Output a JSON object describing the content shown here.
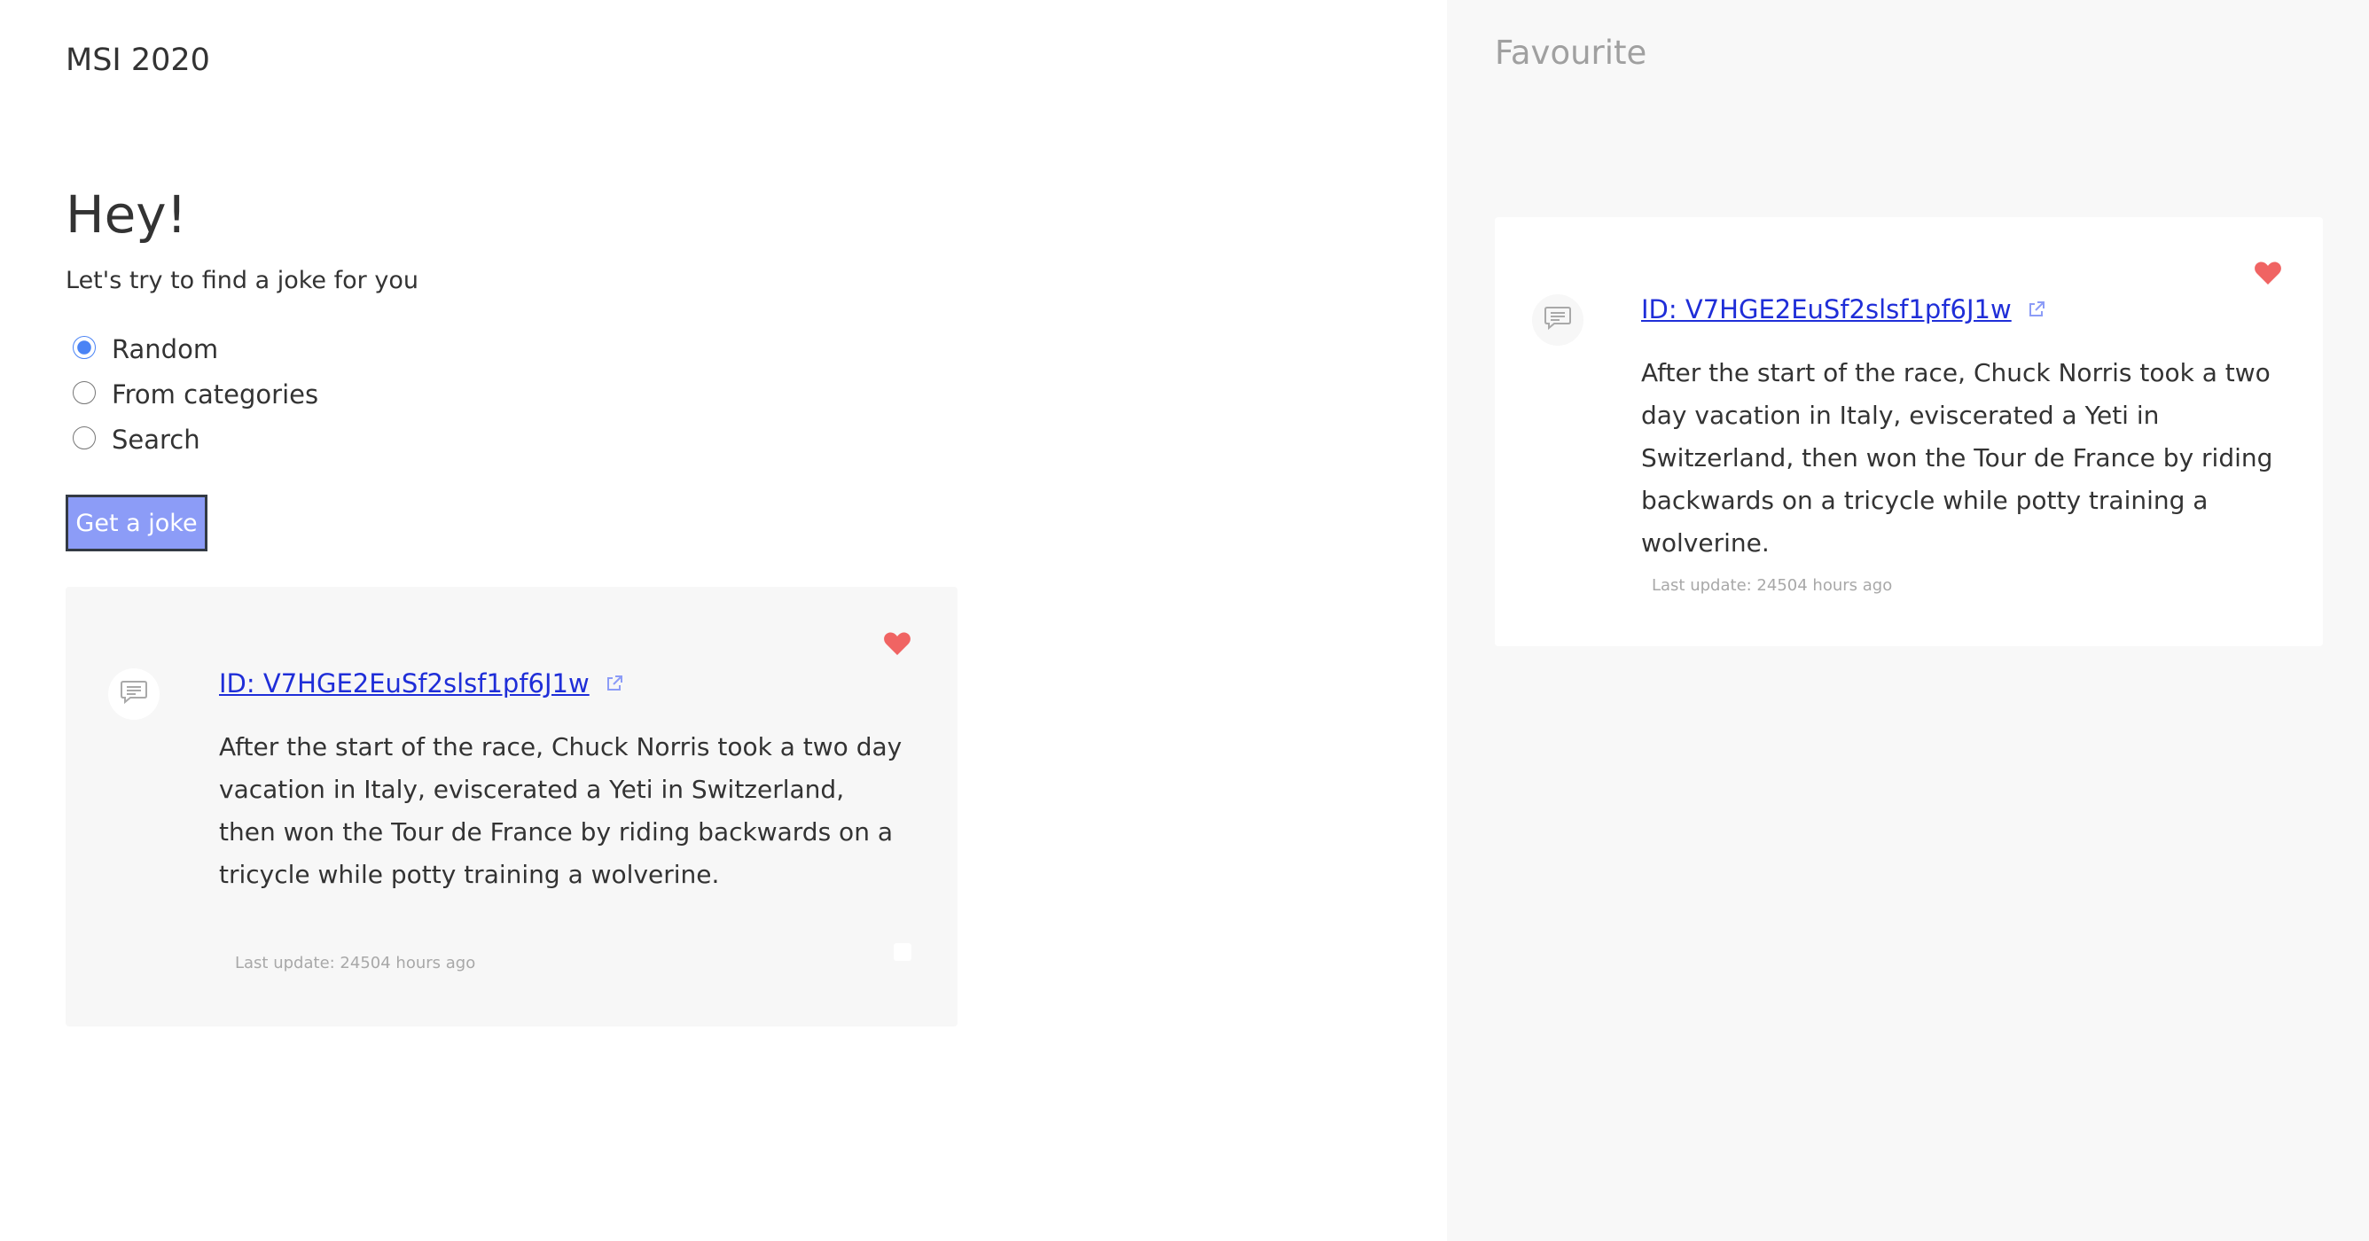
{
  "header": {
    "brand": "MSI 2020"
  },
  "main": {
    "greeting": "Hey!",
    "subtitle": "Let's try to find a joke for you",
    "radio_options": [
      {
        "label": "Random",
        "checked": true
      },
      {
        "label": "From categories",
        "checked": false
      },
      {
        "label": "Search",
        "checked": false
      }
    ],
    "get_joke_label": "Get a joke",
    "joke": {
      "id_text": "ID: V7HGE2EuSf2slsf1pf6J1w",
      "text": "After the start of the race, Chuck Norris took a two day vacation in Italy, eviscerated a Yeti in Switzerland, then won the Tour de France by riding backwards on a tricycle while potty training a wolverine.",
      "last_update": "Last update: 24504 hours ago",
      "favourite": true
    }
  },
  "sidebar": {
    "title": "Favourite",
    "items": [
      {
        "id_text": "ID: V7HGE2EuSf2slsf1pf6J1w",
        "text": "After the start of the race, Chuck Norris took a two day vacation in Italy, eviscerated a Yeti in Switzerland, then won the Tour de France by riding backwards on a tricycle while potty training a wolverine.",
        "last_update": "Last update: 24504 hours ago",
        "favourite": true
      }
    ]
  },
  "icons": {
    "heart": "heart-icon",
    "message": "message-icon",
    "external_link": "external-link-icon"
  },
  "colors": {
    "heart": "#f06463",
    "link": "#1f2ed8",
    "button_bg": "#8c9cf7",
    "radio_accent": "#4a83f5",
    "sidebar_bg": "#f8f8f8",
    "card_bg": "#f7f7f7",
    "muted_text": "#a8a8a8"
  }
}
